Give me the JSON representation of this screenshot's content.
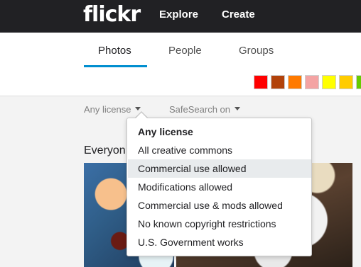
{
  "topnav": {
    "logo": "flickr",
    "links": {
      "explore": "Explore",
      "create": "Create"
    }
  },
  "tabs": [
    {
      "label": "Photos",
      "active": true
    },
    {
      "label": "People",
      "active": false
    },
    {
      "label": "Groups",
      "active": false
    }
  ],
  "color_swatches": [
    "#ff0000",
    "#b2420a",
    "#ff7a00",
    "#f4a3a3",
    "#ffff00",
    "#ffcc00",
    "#66cc00"
  ],
  "filters": {
    "license": "Any license",
    "safesearch": "SafeSearch on"
  },
  "section_heading": "Everyon",
  "license_menu": {
    "items": [
      {
        "label": "Any license",
        "selected": true,
        "hovered": false
      },
      {
        "label": "All creative commons",
        "selected": false,
        "hovered": false
      },
      {
        "label": "Commercial use allowed",
        "selected": false,
        "hovered": true
      },
      {
        "label": "Modifications allowed",
        "selected": false,
        "hovered": false
      },
      {
        "label": "Commercial use & mods allowed",
        "selected": false,
        "hovered": false
      },
      {
        "label": "No known copyright restrictions",
        "selected": false,
        "hovered": false
      },
      {
        "label": "U.S. Government works",
        "selected": false,
        "hovered": false
      }
    ]
  },
  "accent_color": "#008ecf"
}
